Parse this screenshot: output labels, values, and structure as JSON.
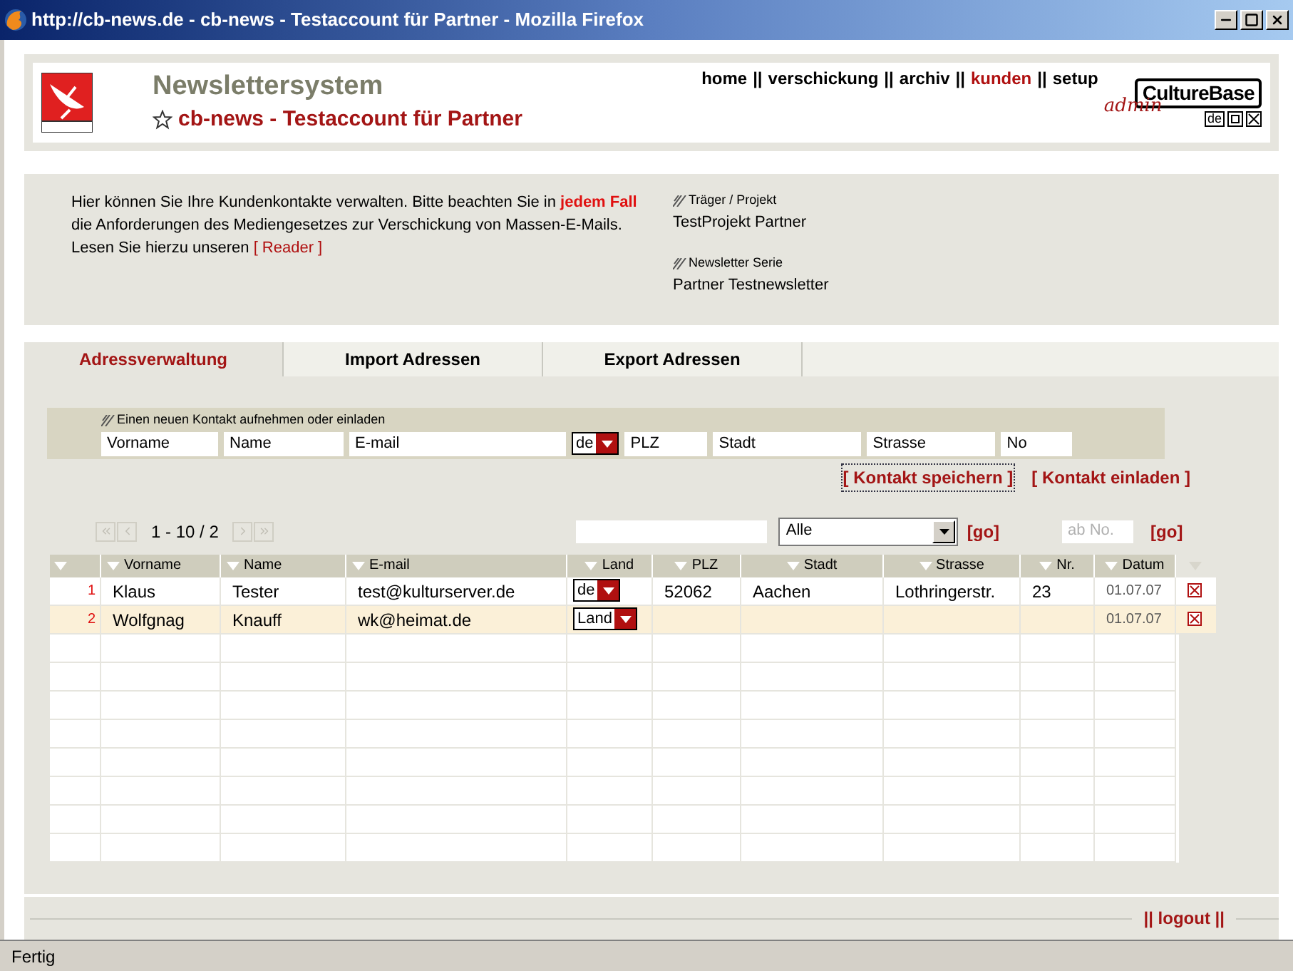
{
  "window": {
    "title": "http://cb-news.de - cb-news - Testaccount für Partner - Mozilla Firefox"
  },
  "header": {
    "app_name": "Newslettersystem",
    "account": "cb-news - Testaccount für Partner",
    "brand": "CultureBase",
    "brand_script": "admin",
    "lang_button": "de"
  },
  "nav": [
    {
      "label": "home",
      "selected": false
    },
    {
      "label": "verschickung",
      "selected": false
    },
    {
      "label": "archiv",
      "selected": false
    },
    {
      "label": "kunden",
      "selected": true
    },
    {
      "label": "setup",
      "selected": false
    }
  ],
  "nav_separator": "||",
  "info": {
    "text": "Hier können Sie Ihre Kundenkontakte verwalten. Bitte beachten Sie in **jedem Fall** die Anforderungen des Mediengesetzes zur Verschickung von Massen-E-Mails. Lesen Sie hierzu unseren",
    "link": "[ Reader ]",
    "fields": [
      {
        "label": "Träger / Projekt",
        "value": "TestProjekt Partner"
      },
      {
        "label": "Newsletter Serie",
        "value": "Partner Testnewsletter"
      }
    ]
  },
  "tabs": [
    {
      "label": "Adressverwaltung",
      "selected": true
    },
    {
      "label": "Import Adressen",
      "selected": false
    },
    {
      "label": "Export Adressen",
      "selected": false
    }
  ],
  "new_contact": {
    "title": "Einen neuen Kontakt aufnehmen oder einladen",
    "fields": [
      {
        "kind": "text",
        "placeholder": "Vorname"
      },
      {
        "kind": "text",
        "placeholder": "Name"
      },
      {
        "kind": "text",
        "placeholder": "E-mail"
      },
      {
        "kind": "select",
        "value": "de"
      },
      {
        "kind": "text",
        "placeholder": "PLZ"
      },
      {
        "kind": "text",
        "placeholder": "Stadt"
      },
      {
        "kind": "text",
        "placeholder": "Strasse"
      },
      {
        "kind": "text",
        "placeholder": "No"
      }
    ],
    "save": "[ Kontakt speichern ]",
    "invite": "[ Kontakt einladen ]"
  },
  "pager": {
    "range": "1 - 10 / 2",
    "filter": "Alle",
    "go": "[go]",
    "from_placeholder": "ab No.",
    "go2": "[go]"
  },
  "table": {
    "columns": [
      "Vorname",
      "Name",
      "E-mail",
      "Land",
      "PLZ",
      "Stadt",
      "Strasse",
      "Nr.",
      "Datum"
    ],
    "rows": [
      {
        "index": "1",
        "vorname": "Klaus",
        "name": "Tester",
        "email": "test@kulturserver.de",
        "land": "de",
        "plz": "52062",
        "stadt": "Aachen",
        "strasse": "Lothringerstr.",
        "nr": "23",
        "datum": "01.07.07",
        "selected": false
      },
      {
        "index": "2",
        "vorname": "Wolfgnag",
        "name": "Knauff",
        "email": "wk@heimat.de",
        "land": "Land",
        "datum": "01.07.07",
        "selected": true
      }
    ]
  },
  "footer": {
    "logout": "|| logout ||"
  },
  "status_bar": "Fertig"
}
